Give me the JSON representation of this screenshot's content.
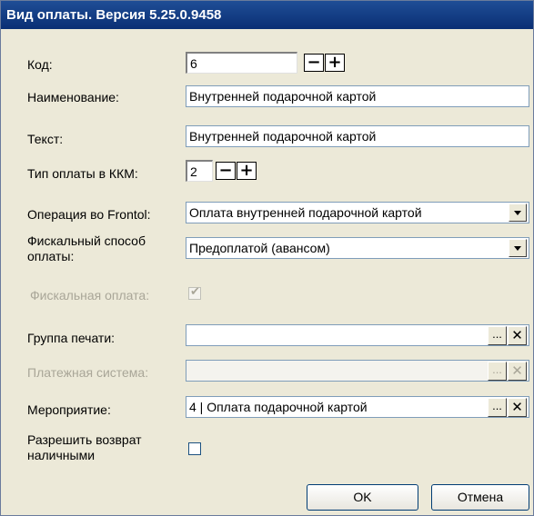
{
  "window": {
    "title": "Вид оплаты. Версия 5.25.0.9458"
  },
  "fields": {
    "code": {
      "label": "Код:",
      "value": "6"
    },
    "name": {
      "label": "Наименование:",
      "value": "Внутренней подарочной картой"
    },
    "text": {
      "label": "Текст:",
      "value": "Внутренней подарочной картой"
    },
    "kkm_type": {
      "label": "Тип оплаты в ККМ:",
      "value": "2"
    },
    "operation": {
      "label": "Операция во Frontol:",
      "value": "Оплата внутренней подарочной картой"
    },
    "fiscal_method": {
      "label_line1": "Фискальный способ",
      "label_line2": "оплаты:",
      "value": "Предоплатой (авансом)"
    },
    "fiscal_payment": {
      "label": "Фискальная оплата:",
      "checked": true
    },
    "print_group": {
      "label": "Группа печати:",
      "value": ""
    },
    "payment_system": {
      "label": "Платежная система:",
      "value": ""
    },
    "event": {
      "label": "Мероприятие:",
      "value": "4 | Оплата подарочной картой"
    },
    "allow_cash_return": {
      "label_line1": "Разрешить возврат",
      "label_line2": "наличными",
      "checked": false
    }
  },
  "symbols": {
    "minus": "−",
    "plus": "+",
    "ellipsis": "...",
    "clear": "✕",
    "check": "✔"
  },
  "buttons": {
    "ok": "OK",
    "cancel": "Отмена"
  }
}
